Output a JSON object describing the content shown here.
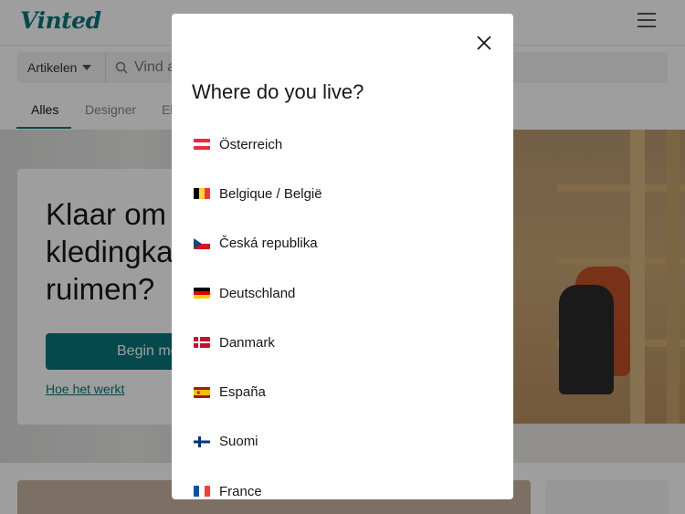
{
  "app": {
    "logo_text": "Vinted",
    "brand_color": "#09777c"
  },
  "header": {
    "category_select": "Artikelen",
    "search_placeholder": "Vind a",
    "tabs": [
      "Alles",
      "Designer",
      "El"
    ]
  },
  "hero": {
    "title": "Klaar om kledingka ruimen?",
    "title_lines": [
      "Klaar om",
      "kledingka",
      "ruimen?"
    ],
    "button_label": "Begin me",
    "link_text": "Hoe het werkt"
  },
  "modal": {
    "title": "Where do you live?",
    "close_icon": "close-icon",
    "countries": [
      {
        "name": "Österreich",
        "flag": "austria-flag-icon"
      },
      {
        "name": "Belgique / België",
        "flag": "belgium-flag-icon"
      },
      {
        "name": "Česká republika",
        "flag": "czech-flag-icon"
      },
      {
        "name": "Deutschland",
        "flag": "germany-flag-icon"
      },
      {
        "name": "Danmark",
        "flag": "denmark-flag-icon"
      },
      {
        "name": "España",
        "flag": "spain-flag-icon"
      },
      {
        "name": "Suomi",
        "flag": "finland-flag-icon"
      },
      {
        "name": "France",
        "flag": "france-flag-icon"
      }
    ]
  }
}
